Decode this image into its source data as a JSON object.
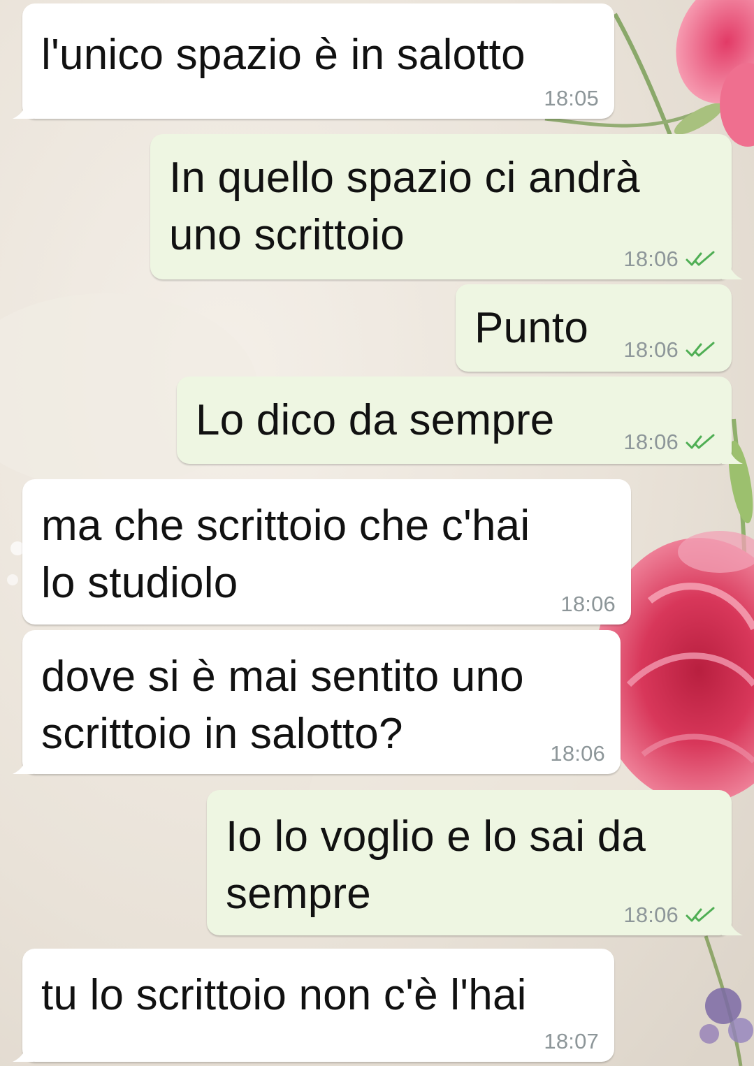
{
  "colors": {
    "incoming_bubble": "#ffffff",
    "outgoing_bubble": "#eef6e2",
    "timestamp": "#8d9699",
    "read_ticks": "#4fae54"
  },
  "messages": [
    {
      "direction": "incoming",
      "text": "l'unico spazio è in salotto",
      "time": "18:05"
    },
    {
      "direction": "outgoing",
      "text": "In quello spazio ci andrà\nuno scrittoio",
      "time": "18:06",
      "status": "read",
      "status_icon": "double-check-icon"
    },
    {
      "direction": "outgoing",
      "text": "Punto",
      "time": "18:06",
      "status": "read",
      "status_icon": "double-check-icon"
    },
    {
      "direction": "outgoing",
      "text": "Lo dico da sempre",
      "time": "18:06",
      "status": "read",
      "status_icon": "double-check-icon"
    },
    {
      "direction": "incoming",
      "text": "ma che scrittoio che c'hai\nlo studiolo",
      "time": "18:06"
    },
    {
      "direction": "incoming",
      "text": "dove si è mai sentito uno\nscrittoio in salotto?",
      "time": "18:06"
    },
    {
      "direction": "outgoing",
      "text": "Io lo voglio e lo sai da\nsempre",
      "time": "18:06",
      "status": "read",
      "status_icon": "double-check-icon"
    },
    {
      "direction": "incoming",
      "text": "tu lo scrittoio non c'è l'hai",
      "time": "18:07"
    }
  ]
}
